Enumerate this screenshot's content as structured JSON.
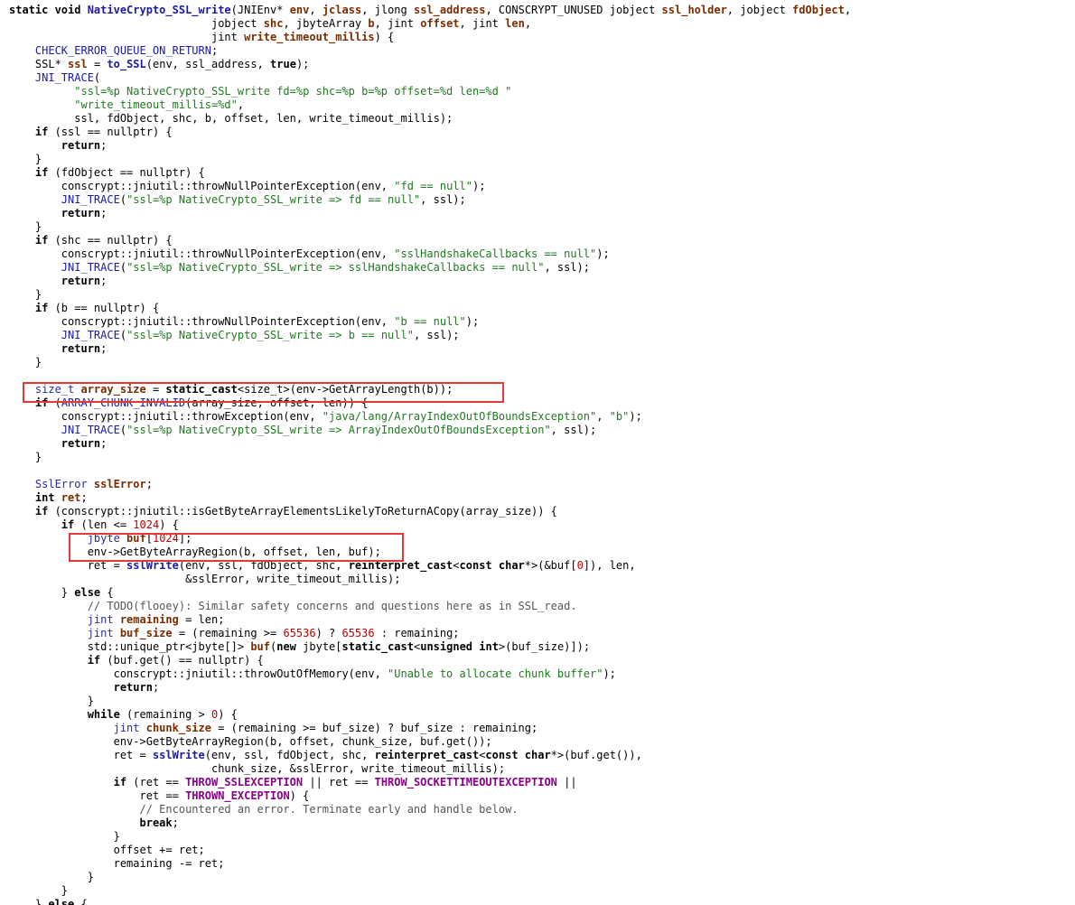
{
  "colors": {
    "background": "#ffffff",
    "highlight_box": "#e53935",
    "keyword": "#000000",
    "function": "#1a1aa6",
    "variable": "#7a2c00",
    "string": "#1f7a1f",
    "number": "#c00000",
    "comment": "#555555",
    "constant": "#8b008b"
  },
  "lines": [
    [
      [
        "kw",
        "static void "
      ],
      [
        "fn",
        "NativeCrypto_SSL_write"
      ],
      [
        "plain",
        "(JNIEnv* "
      ],
      [
        "var",
        "env"
      ],
      [
        "plain",
        ", "
      ],
      [
        "var",
        "jclass"
      ],
      [
        "plain",
        ", jlong "
      ],
      [
        "var",
        "ssl_address"
      ],
      [
        "plain",
        ", CONSCRYPT_UNUSED jobject "
      ],
      [
        "var",
        "ssl_holder"
      ],
      [
        "plain",
        ", jobject "
      ],
      [
        "var",
        "fdObject"
      ],
      [
        "plain",
        ","
      ]
    ],
    [
      [
        "plain",
        "                               jobject "
      ],
      [
        "var",
        "shc"
      ],
      [
        "plain",
        ", jbyteArray "
      ],
      [
        "var",
        "b"
      ],
      [
        "plain",
        ", jint "
      ],
      [
        "var",
        "offset"
      ],
      [
        "plain",
        ", jint "
      ],
      [
        "var",
        "len"
      ],
      [
        "plain",
        ","
      ]
    ],
    [
      [
        "plain",
        "                               jint "
      ],
      [
        "var",
        "write_timeout_millis"
      ],
      [
        "plain",
        ") {"
      ]
    ],
    [
      [
        "mac",
        "    CHECK_ERROR_QUEUE_ON_RETURN"
      ],
      [
        "plain",
        ";"
      ]
    ],
    [
      [
        "plain",
        "    SSL* "
      ],
      [
        "var",
        "ssl"
      ],
      [
        "plain",
        " = "
      ],
      [
        "fn",
        "to_SSL"
      ],
      [
        "plain",
        "(env, ssl_address, "
      ],
      [
        "kw",
        "true"
      ],
      [
        "plain",
        ");"
      ]
    ],
    [
      [
        "mac",
        "    JNI_TRACE"
      ],
      [
        "plain",
        "("
      ]
    ],
    [
      [
        "str",
        "          \"ssl=%p NativeCrypto_SSL_write fd=%p shc=%p b=%p offset=%d len=%d \""
      ]
    ],
    [
      [
        "str",
        "          \"write_timeout_millis=%d\""
      ],
      [
        "plain",
        ","
      ]
    ],
    [
      [
        "plain",
        "          ssl, fdObject, shc, b, offset, len, write_timeout_millis);"
      ]
    ],
    [
      [
        "kw",
        "    if"
      ],
      [
        "plain",
        " (ssl == nullptr) {"
      ]
    ],
    [
      [
        "kw",
        "        return"
      ],
      [
        "plain",
        ";"
      ]
    ],
    [
      [
        "plain",
        "    }"
      ]
    ],
    [
      [
        "kw",
        "    if"
      ],
      [
        "plain",
        " (fdObject == nullptr) {"
      ]
    ],
    [
      [
        "plain",
        "        conscrypt::jniutil::throwNullPointerException(env, "
      ],
      [
        "str",
        "\"fd == null\""
      ],
      [
        "plain",
        ");"
      ]
    ],
    [
      [
        "mac",
        "        JNI_TRACE"
      ],
      [
        "plain",
        "("
      ],
      [
        "str",
        "\"ssl=%p NativeCrypto_SSL_write => fd == null\""
      ],
      [
        "plain",
        ", ssl);"
      ]
    ],
    [
      [
        "kw",
        "        return"
      ],
      [
        "plain",
        ";"
      ]
    ],
    [
      [
        "plain",
        "    }"
      ]
    ],
    [
      [
        "kw",
        "    if"
      ],
      [
        "plain",
        " (shc == nullptr) {"
      ]
    ],
    [
      [
        "plain",
        "        conscrypt::jniutil::throwNullPointerException(env, "
      ],
      [
        "str",
        "\"sslHandshakeCallbacks == null\""
      ],
      [
        "plain",
        ");"
      ]
    ],
    [
      [
        "mac",
        "        JNI_TRACE"
      ],
      [
        "plain",
        "("
      ],
      [
        "str",
        "\"ssl=%p NativeCrypto_SSL_write => sslHandshakeCallbacks == null\""
      ],
      [
        "plain",
        ", ssl);"
      ]
    ],
    [
      [
        "kw",
        "        return"
      ],
      [
        "plain",
        ";"
      ]
    ],
    [
      [
        "plain",
        "    }"
      ]
    ],
    [
      [
        "kw",
        "    if"
      ],
      [
        "plain",
        " (b == nullptr) {"
      ]
    ],
    [
      [
        "plain",
        "        conscrypt::jniutil::throwNullPointerException(env, "
      ],
      [
        "str",
        "\"b == null\""
      ],
      [
        "plain",
        ");"
      ]
    ],
    [
      [
        "mac",
        "        JNI_TRACE"
      ],
      [
        "plain",
        "("
      ],
      [
        "str",
        "\"ssl=%p NativeCrypto_SSL_write => b == null\""
      ],
      [
        "plain",
        ", ssl);"
      ]
    ],
    [
      [
        "kw",
        "        return"
      ],
      [
        "plain",
        ";"
      ]
    ],
    [
      [
        "plain",
        "    }"
      ]
    ],
    [
      [
        "plain",
        ""
      ]
    ],
    [
      [
        "type",
        "    size_t "
      ],
      [
        "var",
        "array_size"
      ],
      [
        "plain",
        " = "
      ],
      [
        "kw",
        "static_cast"
      ],
      [
        "plain",
        "<size_t>(env->GetArrayLength(b));"
      ]
    ],
    [
      [
        "kw",
        "    if"
      ],
      [
        "plain",
        " ("
      ],
      [
        "mac",
        "ARRAY_CHUNK_INVALID"
      ],
      [
        "plain",
        "(array_size, offset, len)) {"
      ]
    ],
    [
      [
        "plain",
        "        conscrypt::jniutil::throwException(env, "
      ],
      [
        "str",
        "\"java/lang/ArrayIndexOutOfBoundsException\""
      ],
      [
        "plain",
        ", "
      ],
      [
        "str",
        "\"b\""
      ],
      [
        "plain",
        ");"
      ]
    ],
    [
      [
        "mac",
        "        JNI_TRACE"
      ],
      [
        "plain",
        "("
      ],
      [
        "str",
        "\"ssl=%p NativeCrypto_SSL_write => ArrayIndexOutOfBoundsException\""
      ],
      [
        "plain",
        ", ssl);"
      ]
    ],
    [
      [
        "kw",
        "        return"
      ],
      [
        "plain",
        ";"
      ]
    ],
    [
      [
        "plain",
        "    }"
      ]
    ],
    [
      [
        "plain",
        ""
      ]
    ],
    [
      [
        "type",
        "    SslError "
      ],
      [
        "var",
        "sslError"
      ],
      [
        "plain",
        ";"
      ]
    ],
    [
      [
        "kw",
        "    int "
      ],
      [
        "var",
        "ret"
      ],
      [
        "plain",
        ";"
      ]
    ],
    [
      [
        "kw",
        "    if"
      ],
      [
        "plain",
        " (conscrypt::jniutil::isGetByteArrayElementsLikelyToReturnACopy(array_size)) {"
      ]
    ],
    [
      [
        "kw",
        "        if"
      ],
      [
        "plain",
        " (len <= "
      ],
      [
        "num",
        "1024"
      ],
      [
        "plain",
        ") {"
      ]
    ],
    [
      [
        "type",
        "            jbyte "
      ],
      [
        "var",
        "buf"
      ],
      [
        "plain",
        "["
      ],
      [
        "num",
        "1024"
      ],
      [
        "plain",
        "];"
      ]
    ],
    [
      [
        "plain",
        "            env->GetByteArrayRegion(b, offset, len, buf);"
      ]
    ],
    [
      [
        "plain",
        "            ret = "
      ],
      [
        "fn",
        "sslWrite"
      ],
      [
        "plain",
        "(env, ssl, fdObject, shc, "
      ],
      [
        "kw",
        "reinterpret_cast"
      ],
      [
        "plain",
        "<"
      ],
      [
        "kw",
        "const char"
      ],
      [
        "plain",
        "*>(&buf["
      ],
      [
        "num",
        "0"
      ],
      [
        "plain",
        "]), len,"
      ]
    ],
    [
      [
        "plain",
        "                           &sslError, write_timeout_millis);"
      ]
    ],
    [
      [
        "plain",
        "        } "
      ],
      [
        "kw",
        "else"
      ],
      [
        "plain",
        " {"
      ]
    ],
    [
      [
        "cmt",
        "            // TODO(flooey): Similar safety concerns and questions here as in SSL_read."
      ]
    ],
    [
      [
        "type",
        "            jint "
      ],
      [
        "var",
        "remaining"
      ],
      [
        "plain",
        " = len;"
      ]
    ],
    [
      [
        "type",
        "            jint "
      ],
      [
        "var",
        "buf_size"
      ],
      [
        "plain",
        " = (remaining >= "
      ],
      [
        "num",
        "65536"
      ],
      [
        "plain",
        ") ? "
      ],
      [
        "num",
        "65536"
      ],
      [
        "plain",
        " : remaining;"
      ]
    ],
    [
      [
        "plain",
        "            std::unique_ptr<jbyte[]> "
      ],
      [
        "var",
        "buf"
      ],
      [
        "plain",
        "("
      ],
      [
        "kw",
        "new"
      ],
      [
        "plain",
        " jbyte["
      ],
      [
        "kw",
        "static_cast"
      ],
      [
        "plain",
        "<"
      ],
      [
        "kw",
        "unsigned int"
      ],
      [
        "plain",
        ">(buf_size)]);"
      ]
    ],
    [
      [
        "kw",
        "            if"
      ],
      [
        "plain",
        " (buf.get() == nullptr) {"
      ]
    ],
    [
      [
        "plain",
        "                conscrypt::jniutil::throwOutOfMemory(env, "
      ],
      [
        "str",
        "\"Unable to allocate chunk buffer\""
      ],
      [
        "plain",
        ");"
      ]
    ],
    [
      [
        "kw",
        "                return"
      ],
      [
        "plain",
        ";"
      ]
    ],
    [
      [
        "plain",
        "            }"
      ]
    ],
    [
      [
        "kw",
        "            while"
      ],
      [
        "plain",
        " (remaining > "
      ],
      [
        "num",
        "0"
      ],
      [
        "plain",
        ") {"
      ]
    ],
    [
      [
        "type",
        "                jint "
      ],
      [
        "var",
        "chunk_size"
      ],
      [
        "plain",
        " = (remaining >= buf_size) ? buf_size : remaining;"
      ]
    ],
    [
      [
        "plain",
        "                env->GetByteArrayRegion(b, offset, chunk_size, buf.get());"
      ]
    ],
    [
      [
        "plain",
        "                ret = "
      ],
      [
        "fn",
        "sslWrite"
      ],
      [
        "plain",
        "(env, ssl, fdObject, shc, "
      ],
      [
        "kw",
        "reinterpret_cast"
      ],
      [
        "plain",
        "<"
      ],
      [
        "kw",
        "const char"
      ],
      [
        "plain",
        "*>(buf.get()),"
      ]
    ],
    [
      [
        "plain",
        "                               chunk_size, &sslError, write_timeout_millis);"
      ]
    ],
    [
      [
        "kw",
        "                if"
      ],
      [
        "plain",
        " (ret == "
      ],
      [
        "const",
        "THROW_SSLEXCEPTION"
      ],
      [
        "plain",
        " || ret == "
      ],
      [
        "const",
        "THROW_SOCKETTIMEOUTEXCEPTION"
      ],
      [
        "plain",
        " ||"
      ]
    ],
    [
      [
        "plain",
        "                    ret == "
      ],
      [
        "const",
        "THROWN_EXCEPTION"
      ],
      [
        "plain",
        ") {"
      ]
    ],
    [
      [
        "cmt",
        "                    // Encountered an error. Terminate early and handle below."
      ]
    ],
    [
      [
        "kw",
        "                    break"
      ],
      [
        "plain",
        ";"
      ]
    ],
    [
      [
        "plain",
        "                }"
      ]
    ],
    [
      [
        "plain",
        "                offset += ret;"
      ]
    ],
    [
      [
        "plain",
        "                remaining -= ret;"
      ]
    ],
    [
      [
        "plain",
        "            }"
      ]
    ],
    [
      [
        "plain",
        "        }"
      ]
    ],
    [
      [
        "plain",
        "    } "
      ],
      [
        "kw",
        "else"
      ],
      [
        "plain",
        " {"
      ]
    ]
  ]
}
